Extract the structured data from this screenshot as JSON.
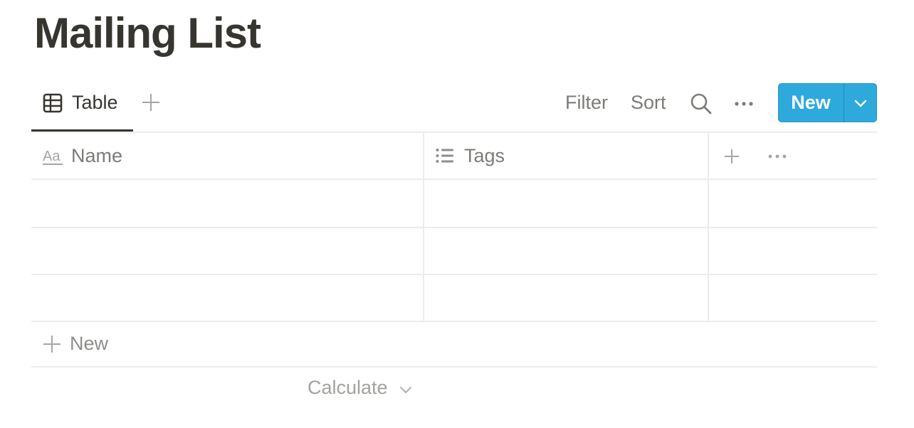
{
  "page": {
    "title": "Mailing List"
  },
  "view_bar": {
    "tabs": [
      {
        "label": "Table",
        "icon": "table-icon",
        "active": true
      }
    ],
    "add_view_icon": "plus-icon",
    "filter_label": "Filter",
    "sort_label": "Sort",
    "search_icon": "search-icon",
    "more_icon": "more-horizontal-icon",
    "new_button": {
      "label": "New",
      "dropdown_icon": "chevron-down-icon",
      "color": "#2ea9dc"
    }
  },
  "table": {
    "columns": [
      {
        "label": "Name",
        "icon": "text-type-icon"
      },
      {
        "label": "Tags",
        "icon": "list-icon"
      }
    ],
    "add_column_icon": "plus-icon",
    "column_options_icon": "more-horizontal-icon",
    "rows": [
      {
        "name": "",
        "tags": ""
      },
      {
        "name": "",
        "tags": ""
      },
      {
        "name": "",
        "tags": ""
      }
    ],
    "add_row": {
      "label": "New",
      "icon": "plus-icon"
    },
    "calculate": {
      "label": "Calculate",
      "icon": "chevron-down-icon"
    }
  }
}
